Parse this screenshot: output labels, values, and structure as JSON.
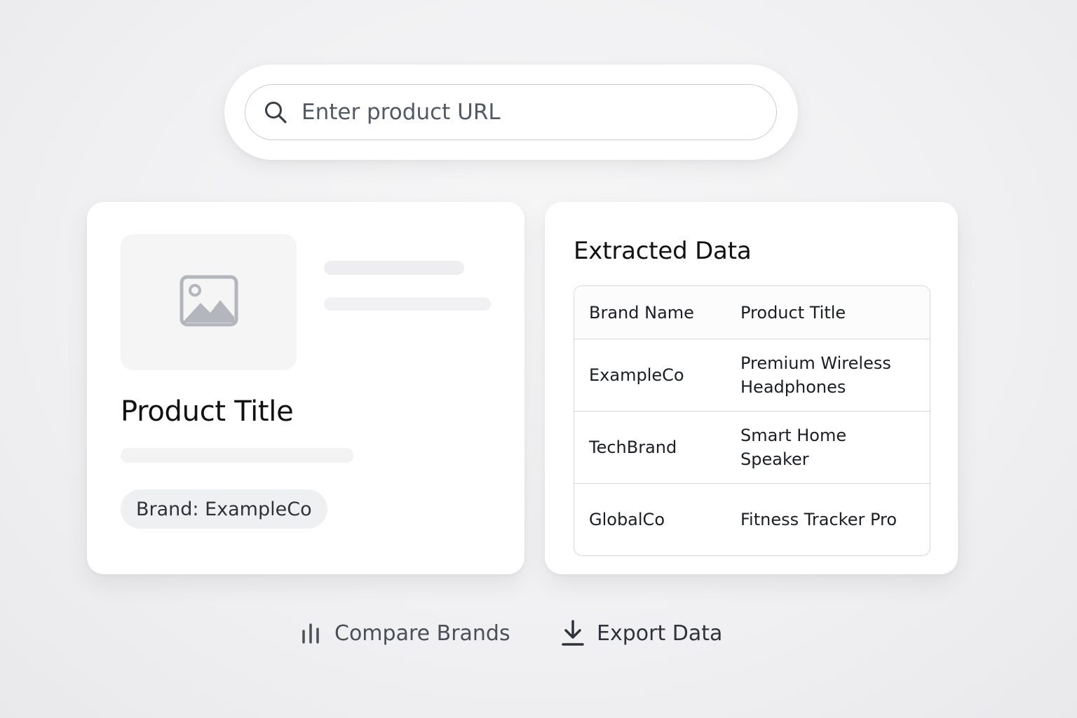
{
  "search": {
    "placeholder": "Enter product URL",
    "icon": "search-icon"
  },
  "product_card": {
    "image_icon": "image-icon",
    "title": "Product Title",
    "brand_badge": "Brand: ExampleCo"
  },
  "extracted": {
    "title": "Extracted Data",
    "columns": [
      "Brand Name",
      "Product Title"
    ],
    "rows": [
      {
        "brand": "ExampleCo",
        "product": "Premium Wireless Headphones"
      },
      {
        "brand": "TechBrand",
        "product": "Smart Home Speaker"
      },
      {
        "brand": "GlobalCo",
        "product": "Fitness Tracker Pro"
      }
    ]
  },
  "actions": {
    "compare_label": "Compare Brands",
    "compare_icon": "bar-chart-icon",
    "export_label": "Export Data",
    "export_icon": "download-icon"
  },
  "colors": {
    "background": "#f0f0f2",
    "card": "#ffffff",
    "text": "#111111",
    "muted_text": "#4a5058",
    "border": "#d6d8dc"
  }
}
